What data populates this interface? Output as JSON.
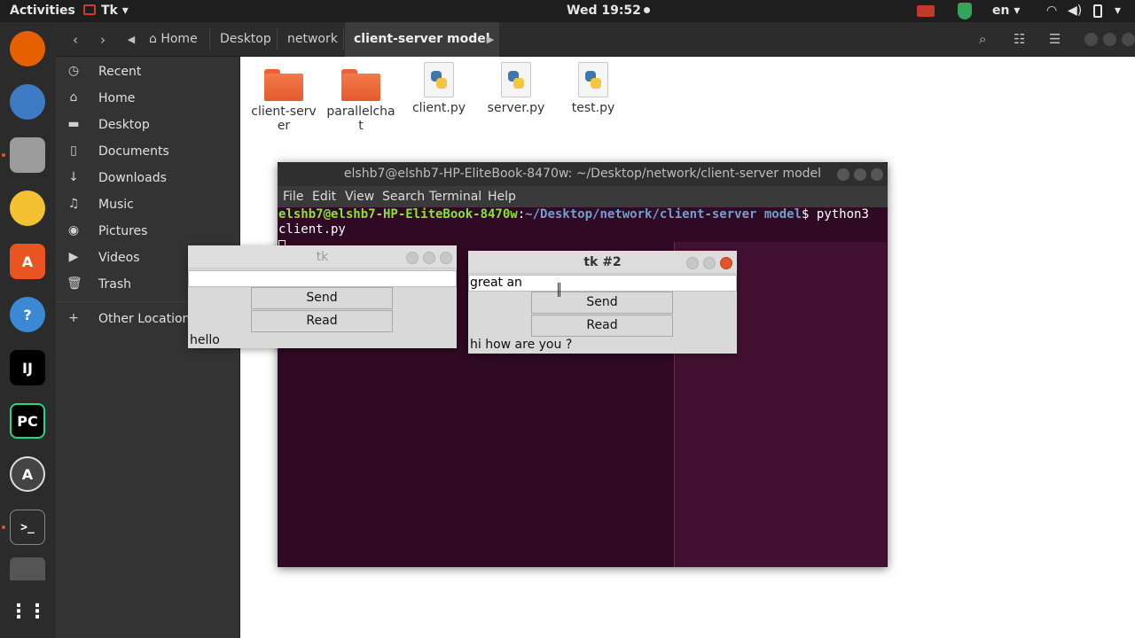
{
  "topbar": {
    "activities": "Activities",
    "app_menu": "Tk",
    "clock": "Wed 19:52",
    "language": "en"
  },
  "dock": {
    "apps": [
      {
        "name": "firefox",
        "color": "#e66000"
      },
      {
        "name": "thunderbird",
        "color": "#3f7bc5"
      },
      {
        "name": "files",
        "color": "#9b9b9b"
      },
      {
        "name": "rhythmbox",
        "color": "#f2c232"
      },
      {
        "name": "software",
        "color": "#e95420"
      },
      {
        "name": "help",
        "color": "#3b88d5"
      },
      {
        "name": "intellij",
        "glyph": "IJ",
        "color": "#000000"
      },
      {
        "name": "pycharm",
        "glyph": "PC",
        "color": "#000000"
      },
      {
        "name": "software-updater",
        "color": "#444444"
      },
      {
        "name": "terminal",
        "glyph": ">_",
        "color": "#2c2c2c"
      }
    ]
  },
  "file_manager": {
    "breadcrumbs": [
      "Home",
      "Desktop",
      "network",
      "client-server model"
    ],
    "sidebar": [
      {
        "label": "Recent",
        "icon": "clock-icon"
      },
      {
        "label": "Home",
        "icon": "home-icon"
      },
      {
        "label": "Desktop",
        "icon": "folder-icon"
      },
      {
        "label": "Documents",
        "icon": "document-icon"
      },
      {
        "label": "Downloads",
        "icon": "download-icon"
      },
      {
        "label": "Music",
        "icon": "music-icon"
      },
      {
        "label": "Pictures",
        "icon": "camera-icon"
      },
      {
        "label": "Videos",
        "icon": "video-icon"
      },
      {
        "label": "Trash",
        "icon": "trash-icon"
      },
      {
        "label": "Other Locations",
        "icon": "plus-icon"
      }
    ],
    "files": [
      {
        "name": "client-server",
        "type": "folder"
      },
      {
        "name": "parallelchat",
        "type": "folder"
      },
      {
        "name": "client.py",
        "type": "python"
      },
      {
        "name": "server.py",
        "type": "python"
      },
      {
        "name": "test.py",
        "type": "python"
      }
    ]
  },
  "terminal": {
    "title": "elshb7@elshb7-HP-EliteBook-8470w: ~/Desktop/network/client-server model",
    "menu": [
      "File",
      "Edit",
      "View",
      "Search",
      "Terminal",
      "Help"
    ],
    "prompt_user": "elshb7@elshb7-HP-EliteBook-8470w",
    "prompt_path": "~/Desktop/network/client-server model",
    "command_line1": "$ python3",
    "command_line2": "client.py"
  },
  "tk_windows": [
    {
      "title": "tk",
      "entry_value": "",
      "send_label": "Send",
      "read_label": "Read",
      "message": "hello"
    },
    {
      "title": "tk #2",
      "entry_value": "great an",
      "send_label": "Send",
      "read_label": "Read",
      "message": "hi how are you ?"
    }
  ]
}
